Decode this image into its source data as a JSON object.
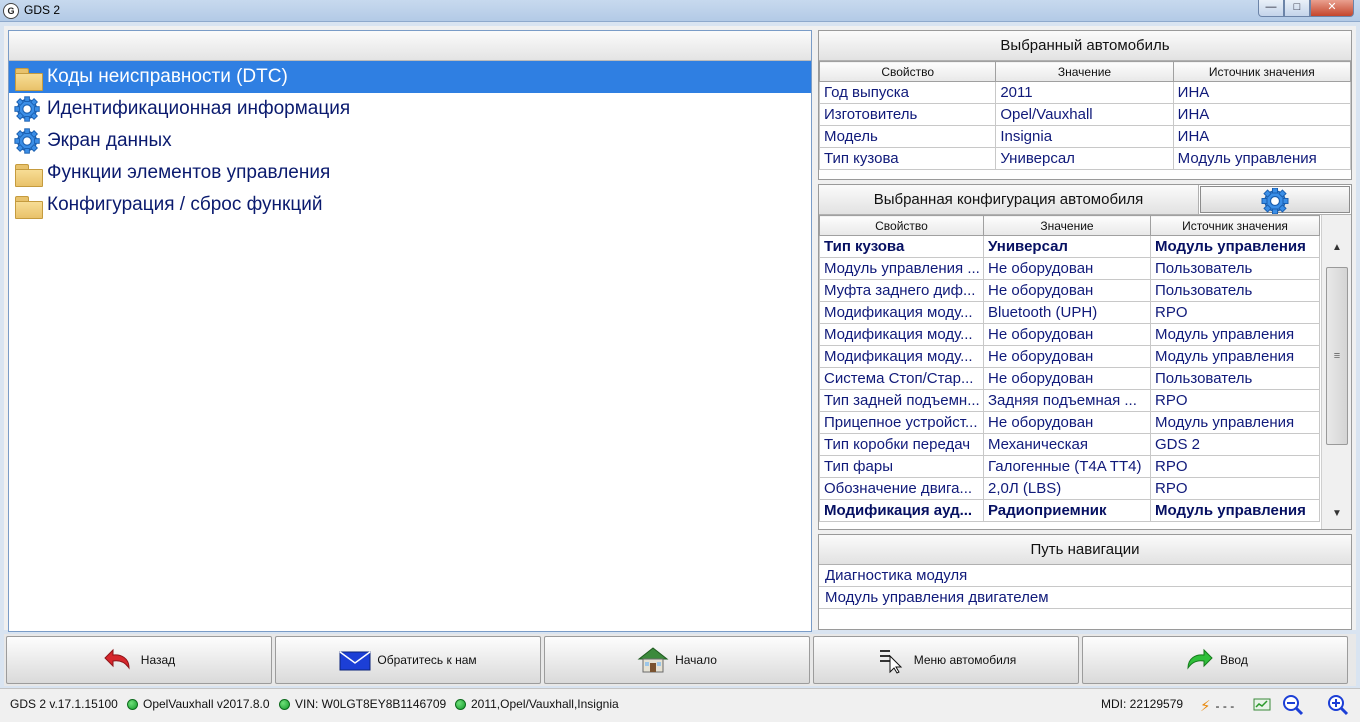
{
  "window": {
    "title": "GDS 2",
    "app_icon_glyph": "G",
    "controls": [
      "minimize",
      "maximize",
      "close"
    ]
  },
  "tree": {
    "items": [
      {
        "label": "Коды неисправности (DTC)",
        "icon": "folder-icon",
        "selected": true
      },
      {
        "label": "Идентификационная информация",
        "icon": "gear-icon",
        "selected": false
      },
      {
        "label": "Экран данных",
        "icon": "gear-icon",
        "selected": false
      },
      {
        "label": "Функции элементов управления",
        "icon": "folder-icon",
        "selected": false
      },
      {
        "label": "Конфигурация / сброс функций",
        "icon": "folder-icon",
        "selected": false
      }
    ]
  },
  "vehicle": {
    "title": "Выбранный автомобиль",
    "columns": [
      "Свойство",
      "Значение",
      "Источник значения"
    ],
    "rows": [
      [
        "Год выпуска",
        "2011",
        "ИНА"
      ],
      [
        "Изготовитель",
        "Opel/Vauxhall",
        "ИНА"
      ],
      [
        "Модель",
        "Insignia",
        "ИНА"
      ],
      [
        "Тип кузова",
        "Универсал",
        "Модуль управления"
      ]
    ]
  },
  "config": {
    "title": "Выбранная конфигурация автомобиля",
    "columns": [
      "Свойство",
      "Значение",
      "Источник значения"
    ],
    "rows": [
      {
        "cells": [
          "Тип кузова",
          "Универсал",
          "Модуль управления"
        ],
        "bold": true
      },
      {
        "cells": [
          "Модуль управления ...",
          "Не оборудован",
          "Пользователь"
        ],
        "bold": false
      },
      {
        "cells": [
          "Муфта заднего диф...",
          "Не оборудован",
          "Пользователь"
        ],
        "bold": false
      },
      {
        "cells": [
          "Модификация моду...",
          "Bluetooth (UPH)",
          "RPO"
        ],
        "bold": false
      },
      {
        "cells": [
          "Модификация моду...",
          "Не оборудован",
          "Модуль управления"
        ],
        "bold": false
      },
      {
        "cells": [
          "Модификация моду...",
          "Не оборудован",
          "Модуль управления"
        ],
        "bold": false
      },
      {
        "cells": [
          "Система Стоп/Стар...",
          "Не оборудован",
          "Пользователь"
        ],
        "bold": false
      },
      {
        "cells": [
          "Тип задней подъемн...",
          "Задняя подъемная ...",
          "RPO"
        ],
        "bold": false
      },
      {
        "cells": [
          "Прицепное устройст...",
          "Не оборудован",
          "Модуль управления"
        ],
        "bold": false
      },
      {
        "cells": [
          "Тип коробки передач",
          "Механическая",
          "GDS 2"
        ],
        "bold": false
      },
      {
        "cells": [
          "Тип фары",
          "Галогенные (T4A TT4)",
          "RPO"
        ],
        "bold": false
      },
      {
        "cells": [
          "Обозначение двига...",
          "2,0Л (LBS)",
          "RPO"
        ],
        "bold": false
      },
      {
        "cells": [
          "Модификация ауд...",
          "Радиоприемник",
          "Модуль управления"
        ],
        "bold": true
      }
    ]
  },
  "nav": {
    "title": "Путь навигации",
    "items": [
      "Диагностика модуля",
      "Модуль управления двигателем"
    ]
  },
  "toolbar": {
    "buttons": [
      {
        "label": "Назад",
        "icon": "back-arrow-icon"
      },
      {
        "label": "Обратитесь к нам",
        "icon": "envelope-icon"
      },
      {
        "label": "Начало",
        "icon": "home-icon"
      },
      {
        "label": "Меню автомобиля",
        "icon": "menu-icon"
      },
      {
        "label": "Ввод",
        "icon": "enter-arrow-icon"
      }
    ]
  },
  "status": {
    "version": "GDS 2 v.17.1.15100",
    "dataset": "OpelVauxhall v2017.8.0",
    "vin": "VIN: W0LGT8EY8B1146709",
    "vehicle": "2011,Opel/Vauxhall,Insignia",
    "mdi": "MDI: 22129579",
    "link": "- - -"
  },
  "colors": {
    "selection": "#2f7fe2",
    "text_blue": "#101a7a",
    "status_green": "#129a2a"
  }
}
